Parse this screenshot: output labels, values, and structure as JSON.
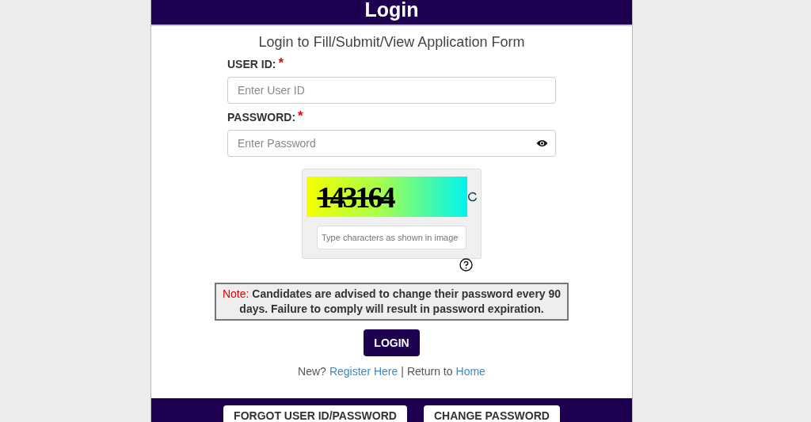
{
  "header": {
    "title": "Login"
  },
  "subtitle": "Login to Fill/Submit/View Application Form",
  "fields": [
    {
      "label": "USER ID:",
      "required_mark": "*",
      "placeholder": "Enter User ID",
      "kind": "text"
    },
    {
      "label": "PASSWORD:",
      "required_mark": "*",
      "placeholder": "Enter Password",
      "kind": "password"
    }
  ],
  "captcha": {
    "code": "143164",
    "placeholder": "Type characters as shown in image"
  },
  "note": {
    "label": "Note:",
    "text": "Candidates are advised to change their password every 90 days. Failure to comply will result in password expiration."
  },
  "login_button": "LOGIN",
  "links": {
    "new_text": "New?",
    "register": "Register Here",
    "separator": "|",
    "return_text": "Return to",
    "home": "Home"
  },
  "footer_buttons": [
    "FORGOT USER ID/PASSWORD",
    "CHANGE PASSWORD"
  ]
}
